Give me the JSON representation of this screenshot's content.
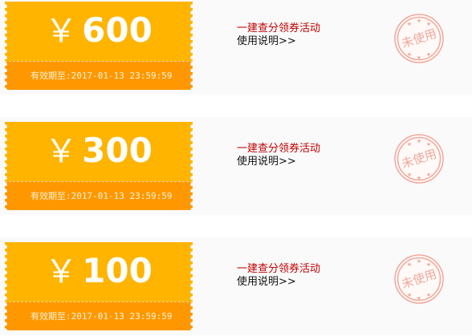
{
  "coupons": [
    {
      "currency": "￥",
      "value": "600",
      "expiry_label": "有效期至",
      "expiry_value": ":2017-01-13 23:59:59",
      "activity": "一建查分领券活动",
      "usage_link": "使用说明>>",
      "stamp": "未使用"
    },
    {
      "currency": "￥",
      "value": "300",
      "expiry_label": "有效期至",
      "expiry_value": ":2017-01-13 23:59:59",
      "activity": "一建查分领券活动",
      "usage_link": "使用说明>>",
      "stamp": "未使用"
    },
    {
      "currency": "￥",
      "value": "100",
      "expiry_label": "有效期至",
      "expiry_value": ":2017-01-13 23:59:59",
      "activity": "一建查分领券活动",
      "usage_link": "使用说明>>",
      "stamp": "未使用"
    }
  ],
  "colors": {
    "ticket_top": "#ffb400",
    "ticket_bottom": "#ff9800",
    "activity_text": "#c00000",
    "stamp": "#f2a79a",
    "row_background": "#fafafa"
  }
}
